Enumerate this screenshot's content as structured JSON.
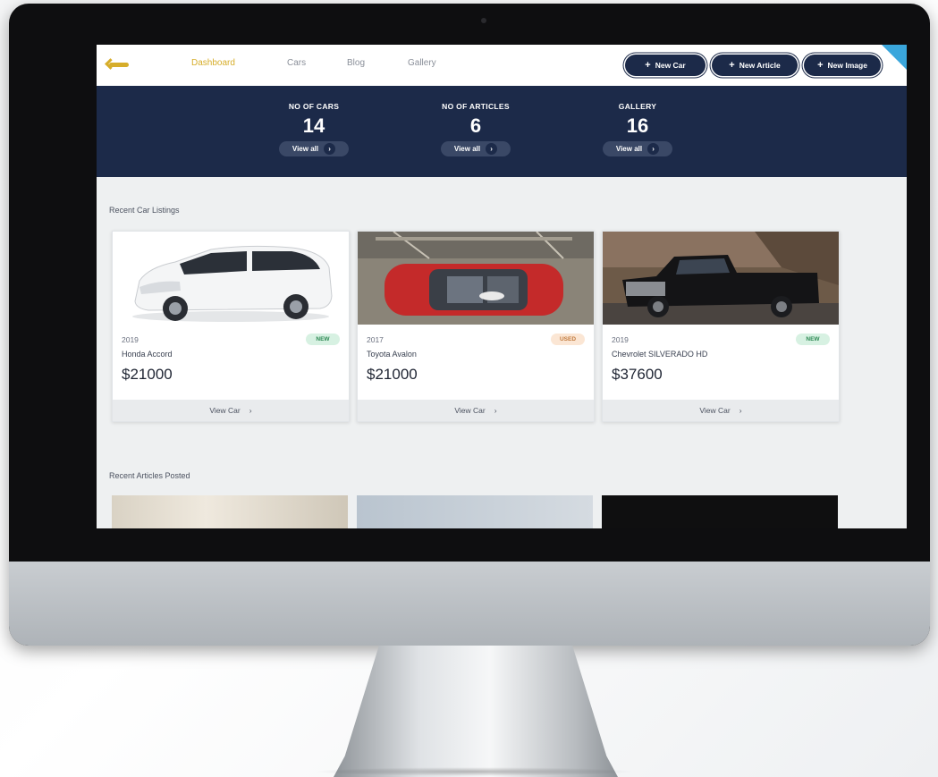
{
  "nav": {
    "links": [
      "Dashboard",
      "Cars",
      "Blog",
      "Gallery"
    ],
    "active": "Dashboard",
    "buttons": [
      "New Car",
      "New Article",
      "New Image"
    ]
  },
  "stats": [
    {
      "label": "NO OF CARS",
      "value": "14",
      "link": "View all"
    },
    {
      "label": "NO OF ARTICLES",
      "value": "6",
      "link": "View all"
    },
    {
      "label": "GALLERY",
      "value": "16",
      "link": "View all"
    }
  ],
  "recent_cars": {
    "title": "Recent Car Listings",
    "cars": [
      {
        "year": "2019",
        "model": "Honda Accord",
        "price": "$21000",
        "badge": "NEW",
        "action": "View Car"
      },
      {
        "year": "2017",
        "model": "Toyota Avalon",
        "price": "$21000",
        "badge": "USED",
        "action": "View Car"
      },
      {
        "year": "2019",
        "model": "Chevrolet SILVERADO HD",
        "price": "$37600",
        "badge": "NEW",
        "action": "View Car"
      }
    ]
  },
  "recent_articles": {
    "title": "Recent Articles Posted"
  },
  "colors": {
    "accent": "#d6ad2a",
    "navy": "#1c2a49",
    "new_badge": "#d7f1e2",
    "used_badge": "#fbe6d4"
  }
}
